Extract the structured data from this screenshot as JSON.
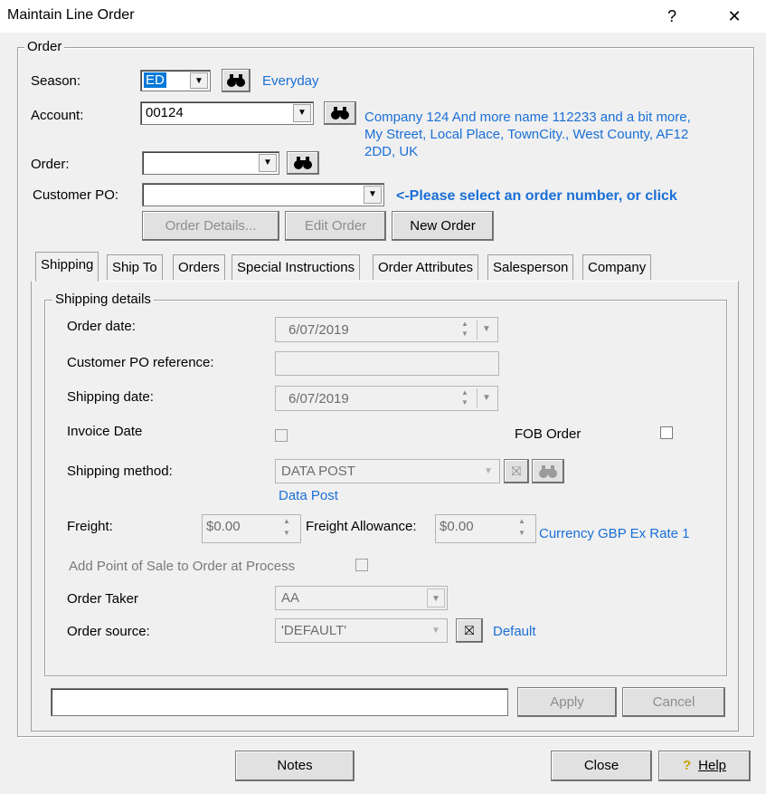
{
  "window": {
    "title": "Maintain Line Order",
    "help_glyph": "?",
    "close_glyph": "✕"
  },
  "order_group": {
    "label": "Order",
    "season_label": "Season:",
    "season_value": "ED",
    "season_desc": "Everyday",
    "account_label": "Account:",
    "account_value": "00124",
    "account_desc": "Company 124 And more name 112233 and a bit more,\nMy Street, Local Place, TownCity., West County, AF12\n2DD, UK",
    "order_label": "Order:",
    "order_value": "",
    "customer_po_label": "Customer PO:",
    "customer_po_value": "",
    "hint": "<-Please select an order number, or click",
    "order_details_button": "Order Details...",
    "edit_order_button": "Edit Order",
    "new_order_button": "New Order"
  },
  "tabs": [
    "Shipping",
    "Ship To",
    "Orders",
    "Special Instructions",
    "Order Attributes",
    "Salesperson",
    "Company"
  ],
  "shipping": {
    "group_label": "Shipping details",
    "order_date_label": "Order date:",
    "order_date_value": "6/07/2019",
    "customer_po_ref_label": "Customer PO reference:",
    "customer_po_ref_value": "",
    "shipping_date_label": "Shipping date:",
    "shipping_date_value": "6/07/2019",
    "invoice_date_label": "Invoice Date",
    "fob_order_label": "FOB Order",
    "shipping_method_label": "Shipping method:",
    "shipping_method_value": "DATA POST",
    "shipping_method_desc": "Data Post",
    "freight_label": "Freight:",
    "freight_value": "$0.00",
    "freight_allowance_label": "Freight Allowance:",
    "freight_allowance_value": "$0.00",
    "currency_text": "Currency GBP Ex Rate 1",
    "pos_label": "Add Point of Sale to Order at Process",
    "order_taker_label": "Order Taker",
    "order_taker_value": "AA",
    "order_source_label": "Order source:",
    "order_source_value": "'DEFAULT'",
    "order_source_desc": "Default"
  },
  "footer": {
    "status_text": "",
    "apply_button": "Apply",
    "cancel_button": "Cancel",
    "notes_button": "Notes",
    "close_button": "Close",
    "help_button": "Help"
  }
}
